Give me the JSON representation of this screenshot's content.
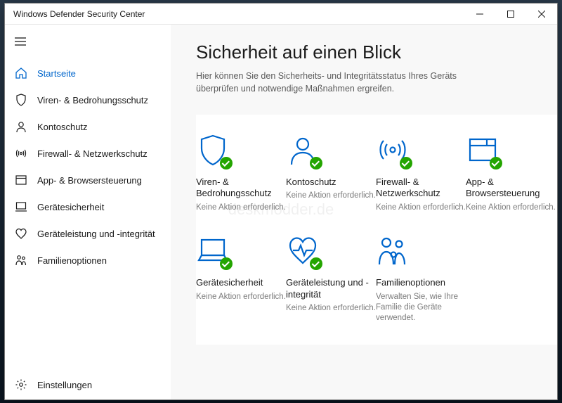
{
  "window": {
    "title": "Windows Defender Security Center"
  },
  "sidebar": {
    "items": [
      {
        "label": "Startseite"
      },
      {
        "label": "Viren- & Bedrohungsschutz"
      },
      {
        "label": "Kontoschutz"
      },
      {
        "label": "Firewall- & Netzwerkschutz"
      },
      {
        "label": "App- & Browsersteuerung"
      },
      {
        "label": "Gerätesicherheit"
      },
      {
        "label": "Geräteleistung und -integrität"
      },
      {
        "label": "Familienoptionen"
      }
    ],
    "settings_label": "Einstellungen"
  },
  "main": {
    "heading": "Sicherheit auf einen Blick",
    "subtitle": "Hier können Sie den Sicherheits- und Integritätsstatus Ihres Geräts überprüfen und notwendige Maßnahmen ergreifen.",
    "tiles": [
      {
        "title": "Viren- & Bedrohungsschutz",
        "sub": "Keine Aktion erforderlich.",
        "check": true
      },
      {
        "title": "Kontoschutz",
        "sub": "Keine Aktion erforderlich.",
        "check": true
      },
      {
        "title": "Firewall- & Netzwerkschutz",
        "sub": "Keine Aktion erforderlich.",
        "check": true
      },
      {
        "title": "App- & Browsersteuerung",
        "sub": "Keine Aktion erforderlich.",
        "check": true
      },
      {
        "title": "Gerätesicherheit",
        "sub": "Keine Aktion erforderlich.",
        "check": true
      },
      {
        "title": "Geräteleistung und -integrität",
        "sub": "Keine Aktion erforderlich.",
        "check": true
      },
      {
        "title": "Familienoptionen",
        "sub": "Verwalten Sie, wie Ihre Familie die Geräte verwendet.",
        "check": false
      }
    ]
  },
  "colors": {
    "accent": "#0066cc",
    "icon_stroke": "#0066cc",
    "ok": "#24a500"
  },
  "watermark": "deskmodder.de"
}
